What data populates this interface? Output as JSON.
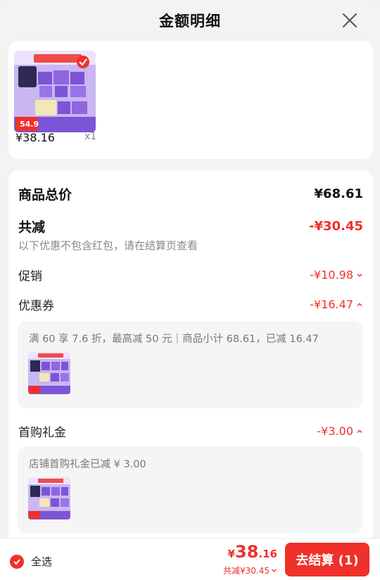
{
  "header": {
    "title": "金额明细"
  },
  "product": {
    "price": "¥38.16",
    "qty": "x1",
    "image_badge_price": "54.9"
  },
  "summary": {
    "total_label": "商品总价",
    "total_value": "¥68.61",
    "discount_label": "共减",
    "discount_value": "-¥30.45",
    "discount_note": "以下优惠不包含红包，请在结算页查看"
  },
  "promo": {
    "label": "促销",
    "value": "-¥10.98"
  },
  "coupon": {
    "label": "优惠券",
    "value": "-¥16.47",
    "detail": "满 60 享 7.6 折，最高减 50 元｜商品小计 68.61，已减 16.47"
  },
  "first_gift": {
    "label": "首购礼金",
    "value": "-¥3.00",
    "detail": "店铺首购礼金已减 ¥ 3.00"
  },
  "bottom": {
    "select_all": "全选",
    "currency": "¥",
    "price_int": "38",
    "price_dec": ".16",
    "saved": "共减¥30.45",
    "checkout": "去结算 (1)"
  },
  "colors": {
    "accent": "#f0302a",
    "product_purple": "#7b55d6"
  }
}
